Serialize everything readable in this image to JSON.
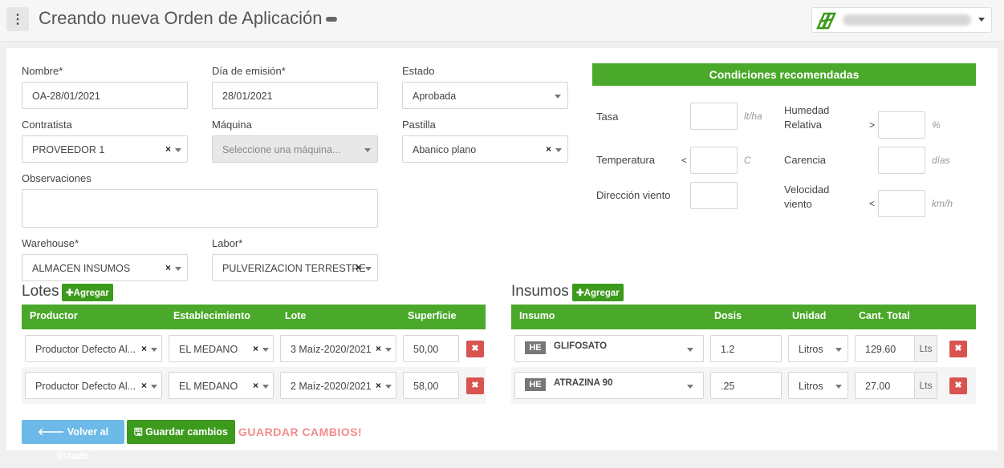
{
  "header": {
    "menu_icon": "⋮",
    "title": "Creando nueva Orden de Aplicación",
    "user_icon": "company-logo-icon"
  },
  "form": {
    "nombre_label": "Nombre*",
    "nombre_value": "OA-28/01/2021",
    "dia_label": "Día de emisión*",
    "dia_value": "28/01/2021",
    "estado_label": "Estado",
    "estado_value": "Aprobada",
    "contratista_label": "Contratista",
    "contratista_value": "PROVEEDOR 1",
    "maquina_label": "Máquina",
    "maquina_placeholder": "Seleccione una máquina...",
    "pastilla_label": "Pastilla",
    "pastilla_value": "Abanico plano",
    "observaciones_label": "Observaciones",
    "observaciones_value": "",
    "warehouse_label": "Warehouse*",
    "warehouse_value": "ALMACEN INSUMOS",
    "labor_label": "Labor*",
    "labor_value": "PULVERIZACION TERRESTRE",
    "clear_symbol": "×"
  },
  "conditions": {
    "title": "Condiciones recomendadas",
    "tasa_label": "Tasa",
    "tasa_unit": "lt/ha",
    "humedad_label_1": "Humedad",
    "humedad_label_2": "Relativa",
    "humedad_sym": ">",
    "humedad_unit": "%",
    "temperatura_label": "Temperatura",
    "temperatura_sym": "<",
    "temperatura_unit": "C",
    "carencia_label": "Carencia",
    "carencia_unit": "días",
    "direccion_label": "Dirección viento",
    "velocidad_label_1": "Velocidad",
    "velocidad_label_2": "viento",
    "velocidad_sym": "<",
    "velocidad_unit": "km/h"
  },
  "lotes": {
    "title": "Lotes",
    "add_label": "✚Agregar",
    "columns": [
      "Productor",
      "Establecimiento",
      "Lote",
      "Superficie"
    ],
    "rows": [
      {
        "productor": "Productor Defecto Al...",
        "establecimiento": "EL MEDANO",
        "lote": "3 Maíz-2020/2021",
        "superficie": "50,00"
      },
      {
        "productor": "Productor Defecto Al...",
        "establecimiento": "EL MEDANO",
        "lote": "2 Maíz-2020/2021",
        "superficie": "58,00"
      }
    ]
  },
  "insumos": {
    "title": "Insumos",
    "add_label": "✚Agregar",
    "columns": [
      "Insumo",
      "Dosis",
      "Unidad",
      "Cant. Total"
    ],
    "rows": [
      {
        "badge": "HE",
        "name": "GLIFOSATO",
        "dosis": "1.2",
        "unidad": "Litros",
        "total": "129.60",
        "total_unit": "Lts"
      },
      {
        "badge": "HE",
        "name": "ATRAZINA 90",
        "dosis": ".25",
        "unidad": "Litros",
        "total": "27.00",
        "total_unit": "Lts"
      }
    ]
  },
  "footer": {
    "back_label": "🡐 Volver al listado",
    "save_label": "🖫 Guardar cambios",
    "warning": "GUARDAR CAMBIOS!"
  },
  "delete_symbol": "✖",
  "colors": {
    "green": "#4aa82a",
    "dark_green": "#3c9a1c",
    "blue": "#6db9e8",
    "red": "#d9534f",
    "warn": "#f58b8b"
  }
}
